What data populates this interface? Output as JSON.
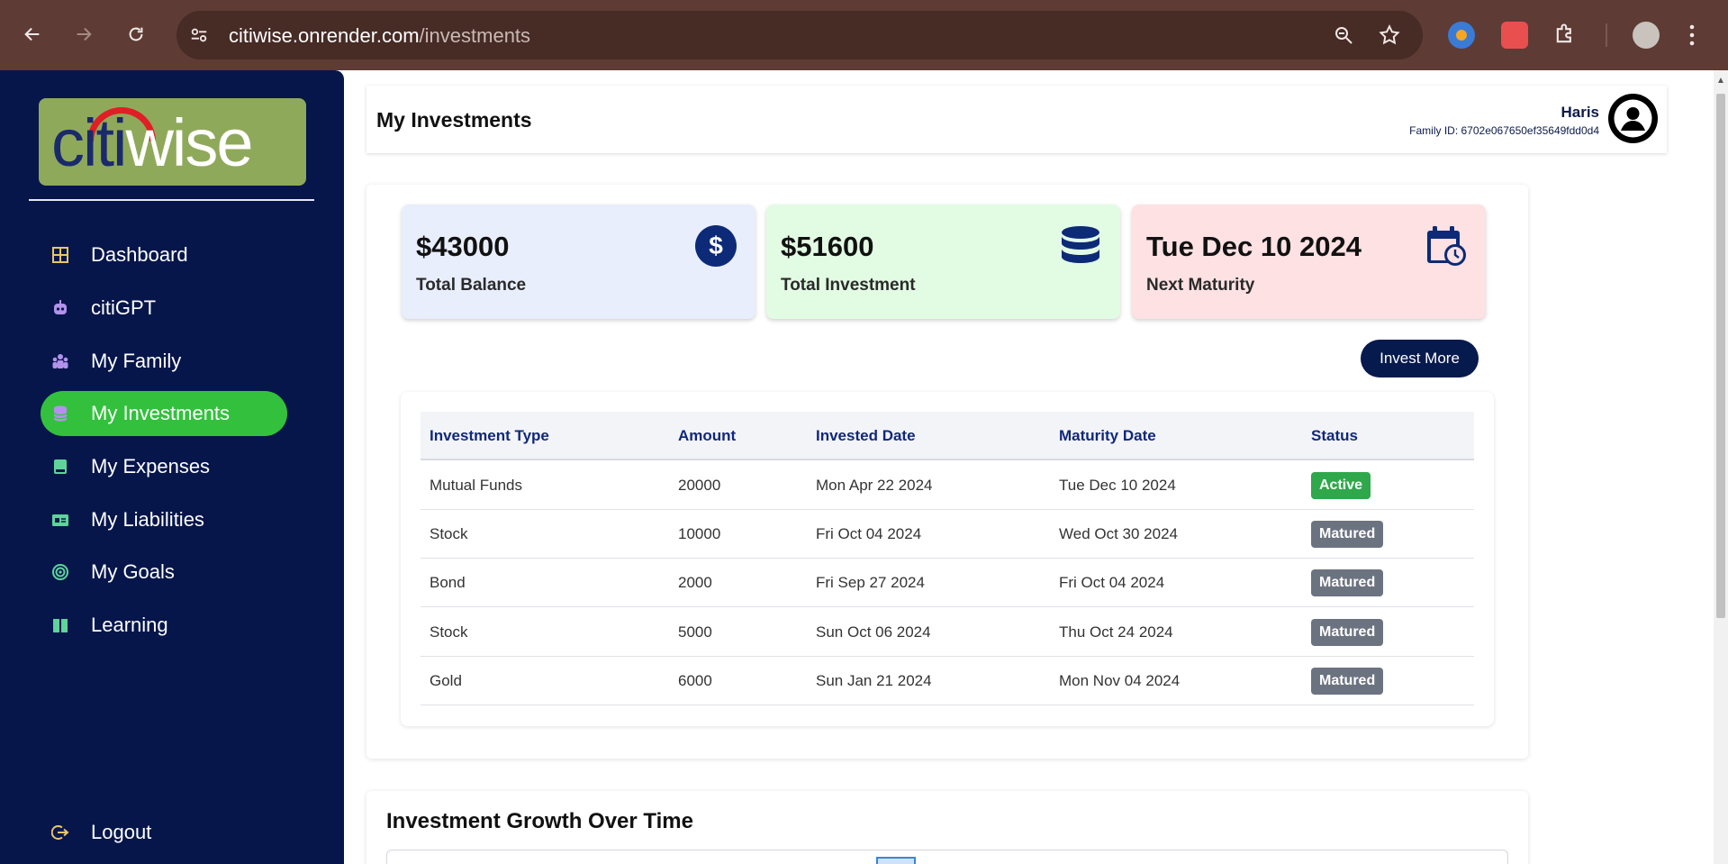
{
  "browser": {
    "url_host": "citiwise.onrender.com",
    "url_path": "/investments"
  },
  "sidebar": {
    "logo": "citiwise",
    "items": [
      {
        "label": "Dashboard",
        "icon": "dashboard-grid-icon",
        "color": "#e8c66a"
      },
      {
        "label": "citiGPT",
        "icon": "robot-icon",
        "color": "#b292ea"
      },
      {
        "label": "My Family",
        "icon": "people-icon",
        "color": "#b292ea"
      },
      {
        "label": "My Investments",
        "icon": "database-icon",
        "color": "#b292ea",
        "active": true
      },
      {
        "label": "My Expenses",
        "icon": "wallet-icon",
        "color": "#5fd39a"
      },
      {
        "label": "My Liabilities",
        "icon": "id-card-icon",
        "color": "#5fd39a"
      },
      {
        "label": "My Goals",
        "icon": "target-icon",
        "color": "#5fd39a"
      },
      {
        "label": "Learning",
        "icon": "book-icon",
        "color": "#5fd39a"
      }
    ],
    "logout": {
      "label": "Logout",
      "icon": "logout-icon",
      "color": "#e8c66a"
    }
  },
  "header": {
    "title": "My Investments",
    "user_name": "Haris",
    "family_id": "Family ID: 6702e067650ef35649fdd0d4"
  },
  "stats": [
    {
      "value": "$43000",
      "label": "Total Balance",
      "bg": "#e8eefc",
      "icon": "dollar-icon"
    },
    {
      "value": "$51600",
      "label": "Total Investment",
      "bg": "#e2fce3",
      "icon": "database-icon"
    },
    {
      "value": "Tue Dec 10 2024",
      "label": "Next Maturity",
      "bg": "#fde1e3",
      "icon": "calendar-clock-icon"
    }
  ],
  "invest_more_label": "Invest More",
  "table": {
    "headers": [
      "Investment Type",
      "Amount",
      "Invested Date",
      "Maturity Date",
      "Status"
    ],
    "rows": [
      {
        "type": "Mutual Funds",
        "amount": "20000",
        "invested": "Mon Apr 22 2024",
        "maturity": "Tue Dec 10 2024",
        "status": "Active"
      },
      {
        "type": "Stock",
        "amount": "10000",
        "invested": "Fri Oct 04 2024",
        "maturity": "Wed Oct 30 2024",
        "status": "Matured"
      },
      {
        "type": "Bond",
        "amount": "2000",
        "invested": "Fri Sep 27 2024",
        "maturity": "Fri Oct 04 2024",
        "status": "Matured"
      },
      {
        "type": "Stock",
        "amount": "5000",
        "invested": "Sun Oct 06 2024",
        "maturity": "Thu Oct 24 2024",
        "status": "Matured"
      },
      {
        "type": "Gold",
        "amount": "6000",
        "invested": "Sun Jan 21 2024",
        "maturity": "Mon Nov 04 2024",
        "status": "Matured"
      }
    ]
  },
  "growth": {
    "title": "Investment Growth Over Time"
  },
  "colors": {
    "sidebar_bg": "#06164b",
    "active_green": "#33c13d",
    "navy": "#071a4d",
    "status_active": "#2ea84a",
    "status_matured": "#6c7380"
  }
}
